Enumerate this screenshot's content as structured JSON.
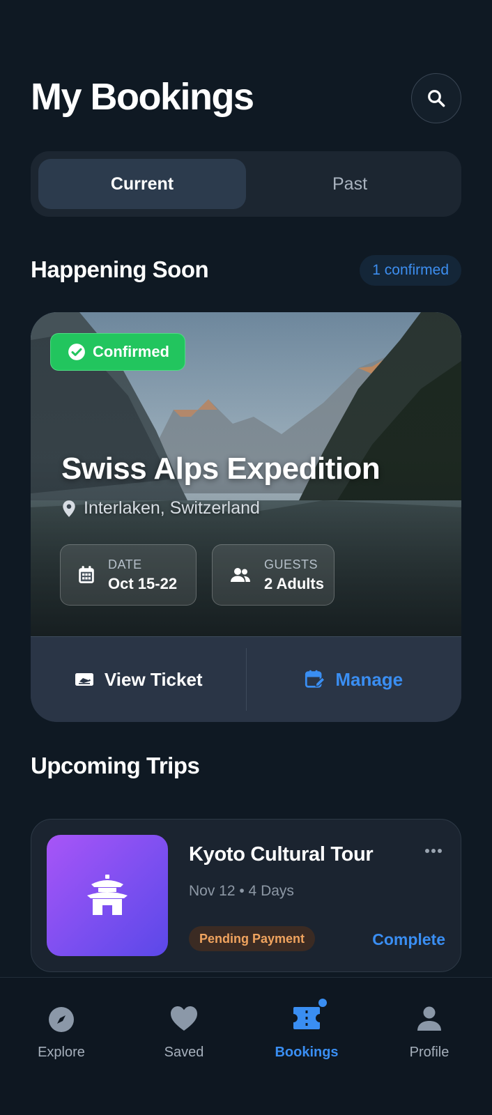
{
  "header": {
    "title": "My Bookings",
    "search_icon": "search-icon"
  },
  "tabs": [
    {
      "label": "Current",
      "active": true
    },
    {
      "label": "Past",
      "active": false
    }
  ],
  "happening_soon": {
    "section_title": "Happening Soon",
    "count_label": "1 confirmed",
    "booking": {
      "status": "Confirmed",
      "title": "Swiss Alps Expedition",
      "location": "Interlaken, Switzerland",
      "date_label": "DATE",
      "date_value": "Oct 15-22",
      "guests_label": "GUESTS",
      "guests_value": "2 Adults",
      "view_ticket_label": "View Ticket",
      "manage_label": "Manage"
    }
  },
  "upcoming": {
    "section_title": "Upcoming Trips",
    "trips": [
      {
        "title": "Kyoto Cultural Tour",
        "meta": "Nov 12 • 4 Days",
        "status": "Pending Payment",
        "action_label": "Complete",
        "icon": "temple-icon"
      }
    ]
  },
  "nav": [
    {
      "label": "Explore",
      "icon": "compass-icon",
      "active": false
    },
    {
      "label": "Saved",
      "icon": "heart-icon",
      "active": false
    },
    {
      "label": "Bookings",
      "icon": "ticket-icon",
      "active": true
    },
    {
      "label": "Profile",
      "icon": "user-icon",
      "active": false
    }
  ],
  "colors": {
    "background": "#0f1923",
    "accent": "#3a8ef2",
    "confirmed": "#22c55e",
    "pending": "#f0a45f"
  }
}
